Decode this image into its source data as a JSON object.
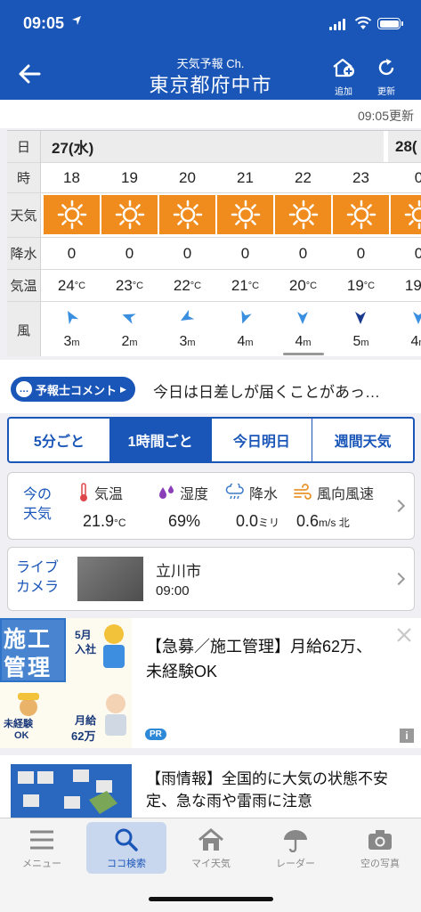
{
  "status": {
    "time": "09:05"
  },
  "header": {
    "subtitle": "天気予報 Ch.",
    "title": "東京都府中市",
    "add_label": "追加",
    "refresh_label": "更新"
  },
  "updated": "09:05更新",
  "forecast": {
    "labels": {
      "date": "日",
      "hour": "時",
      "weather": "天気",
      "precip": "降水",
      "temp": "気温",
      "wind": "風"
    },
    "day1": "27(水)",
    "day2": "28(",
    "hours": [
      "18",
      "19",
      "20",
      "21",
      "22",
      "23",
      "0"
    ],
    "weather": [
      "sunny",
      "sunny",
      "sunny",
      "sunny",
      "sunny",
      "sunny",
      "sunny"
    ],
    "precip": [
      "0",
      "0",
      "0",
      "0",
      "0",
      "0",
      "0"
    ],
    "temp": [
      "24",
      "23",
      "22",
      "21",
      "20",
      "19",
      "19"
    ],
    "temp_unit": "°C",
    "wind_speed": [
      "3",
      "2",
      "3",
      "4",
      "4",
      "5",
      "4"
    ],
    "wind_unit": "m",
    "wind_dir_deg": [
      150,
      110,
      60,
      20,
      0,
      0,
      0
    ]
  },
  "comment": {
    "badge": "予報士コメント",
    "text": "今日は日差しが届くことがあっ…"
  },
  "tabs": [
    {
      "label": "5分ごと"
    },
    {
      "label": "1時間ごと"
    },
    {
      "label": "今日明日"
    },
    {
      "label": "週間天気"
    }
  ],
  "obs": {
    "label": "今の\n天気",
    "temp": {
      "label": "気温",
      "value": "21.9",
      "unit": "°C"
    },
    "humidity": {
      "label": "湿度",
      "value": "69%"
    },
    "precip": {
      "label": "降水",
      "value": "0.0",
      "unit": "ミリ"
    },
    "wind": {
      "label": "風向風速",
      "value": "0.6",
      "unit": "m/s 北"
    }
  },
  "live": {
    "label": "ライブ\nカメラ",
    "place": "立川市",
    "time": "09:00"
  },
  "ad": {
    "banner_title1": "施工",
    "banner_title2": "管理",
    "banner_t1": "5月",
    "banner_t2": "入社",
    "banner_t3": "未経験",
    "banner_t4": "OK",
    "banner_t5": "月給",
    "banner_t6": "62万",
    "text": "【急募／施工管理】月給62万、未経験OK",
    "pr": "PR"
  },
  "ad2": {
    "text": "【雨情報】全国的に大気の状態不安定、急な雨や雷雨に注意"
  },
  "tabbar": [
    {
      "label": "メニュー",
      "icon": "menu-icon"
    },
    {
      "label": "ココ検索",
      "icon": "search-icon"
    },
    {
      "label": "マイ天気",
      "icon": "home-icon"
    },
    {
      "label": "レーダー",
      "icon": "umbrella-icon"
    },
    {
      "label": "空の写真",
      "icon": "camera-icon"
    }
  ],
  "colors": {
    "brand": "#1a56b8",
    "sunny": "#f08c1e"
  }
}
